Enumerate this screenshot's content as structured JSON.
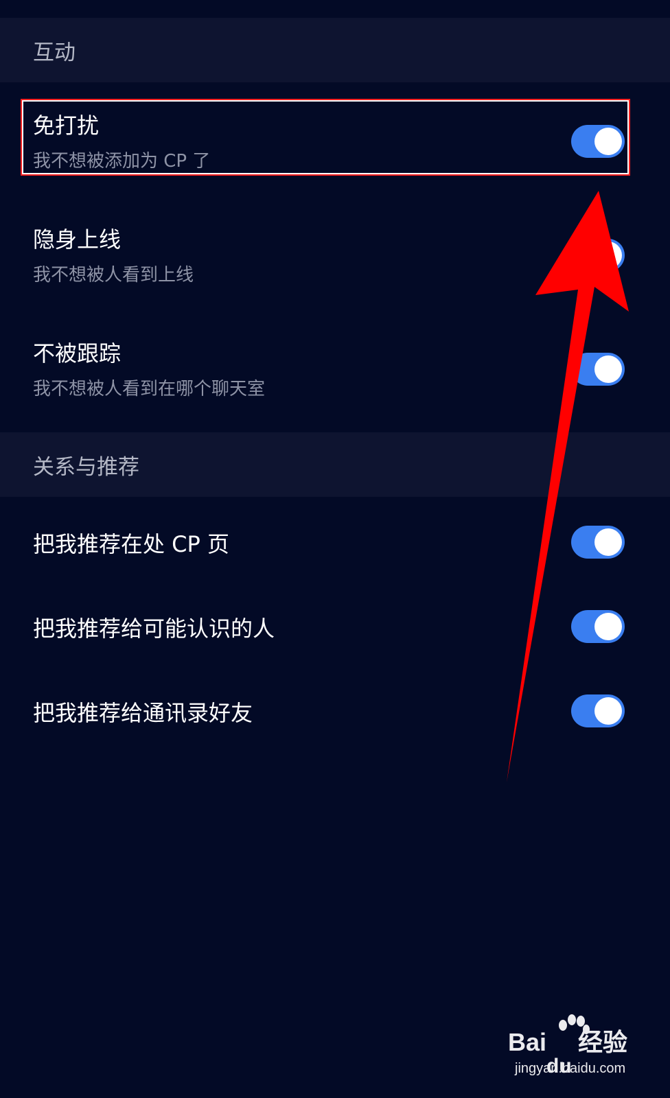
{
  "sections": [
    {
      "header": "互动",
      "items": [
        {
          "title": "免打扰",
          "subtitle": "我不想被添加为 CP 了",
          "toggle_on": true
        },
        {
          "title": "隐身上线",
          "subtitle": "我不想被人看到上线",
          "toggle_on": true
        },
        {
          "title": "不被跟踪",
          "subtitle": "我不想被人看到在哪个聊天室",
          "toggle_on": true
        }
      ]
    },
    {
      "header": "关系与推荐",
      "items": [
        {
          "title": "把我推荐在处 CP 页",
          "toggle_on": true
        },
        {
          "title": "把我推荐给可能认识的人",
          "toggle_on": true
        },
        {
          "title": "把我推荐给通讯录好友",
          "toggle_on": true
        }
      ]
    }
  ],
  "watermark": {
    "logo_prefix": "Bai",
    "logo_middle": "du",
    "logo_suffix": "经验",
    "url": "jingyan.baidu.com"
  },
  "colors": {
    "background": "#030a26",
    "section_header_bg": "#0e1430",
    "toggle_on": "#3a7ef0",
    "annotation": "#ff0000"
  }
}
